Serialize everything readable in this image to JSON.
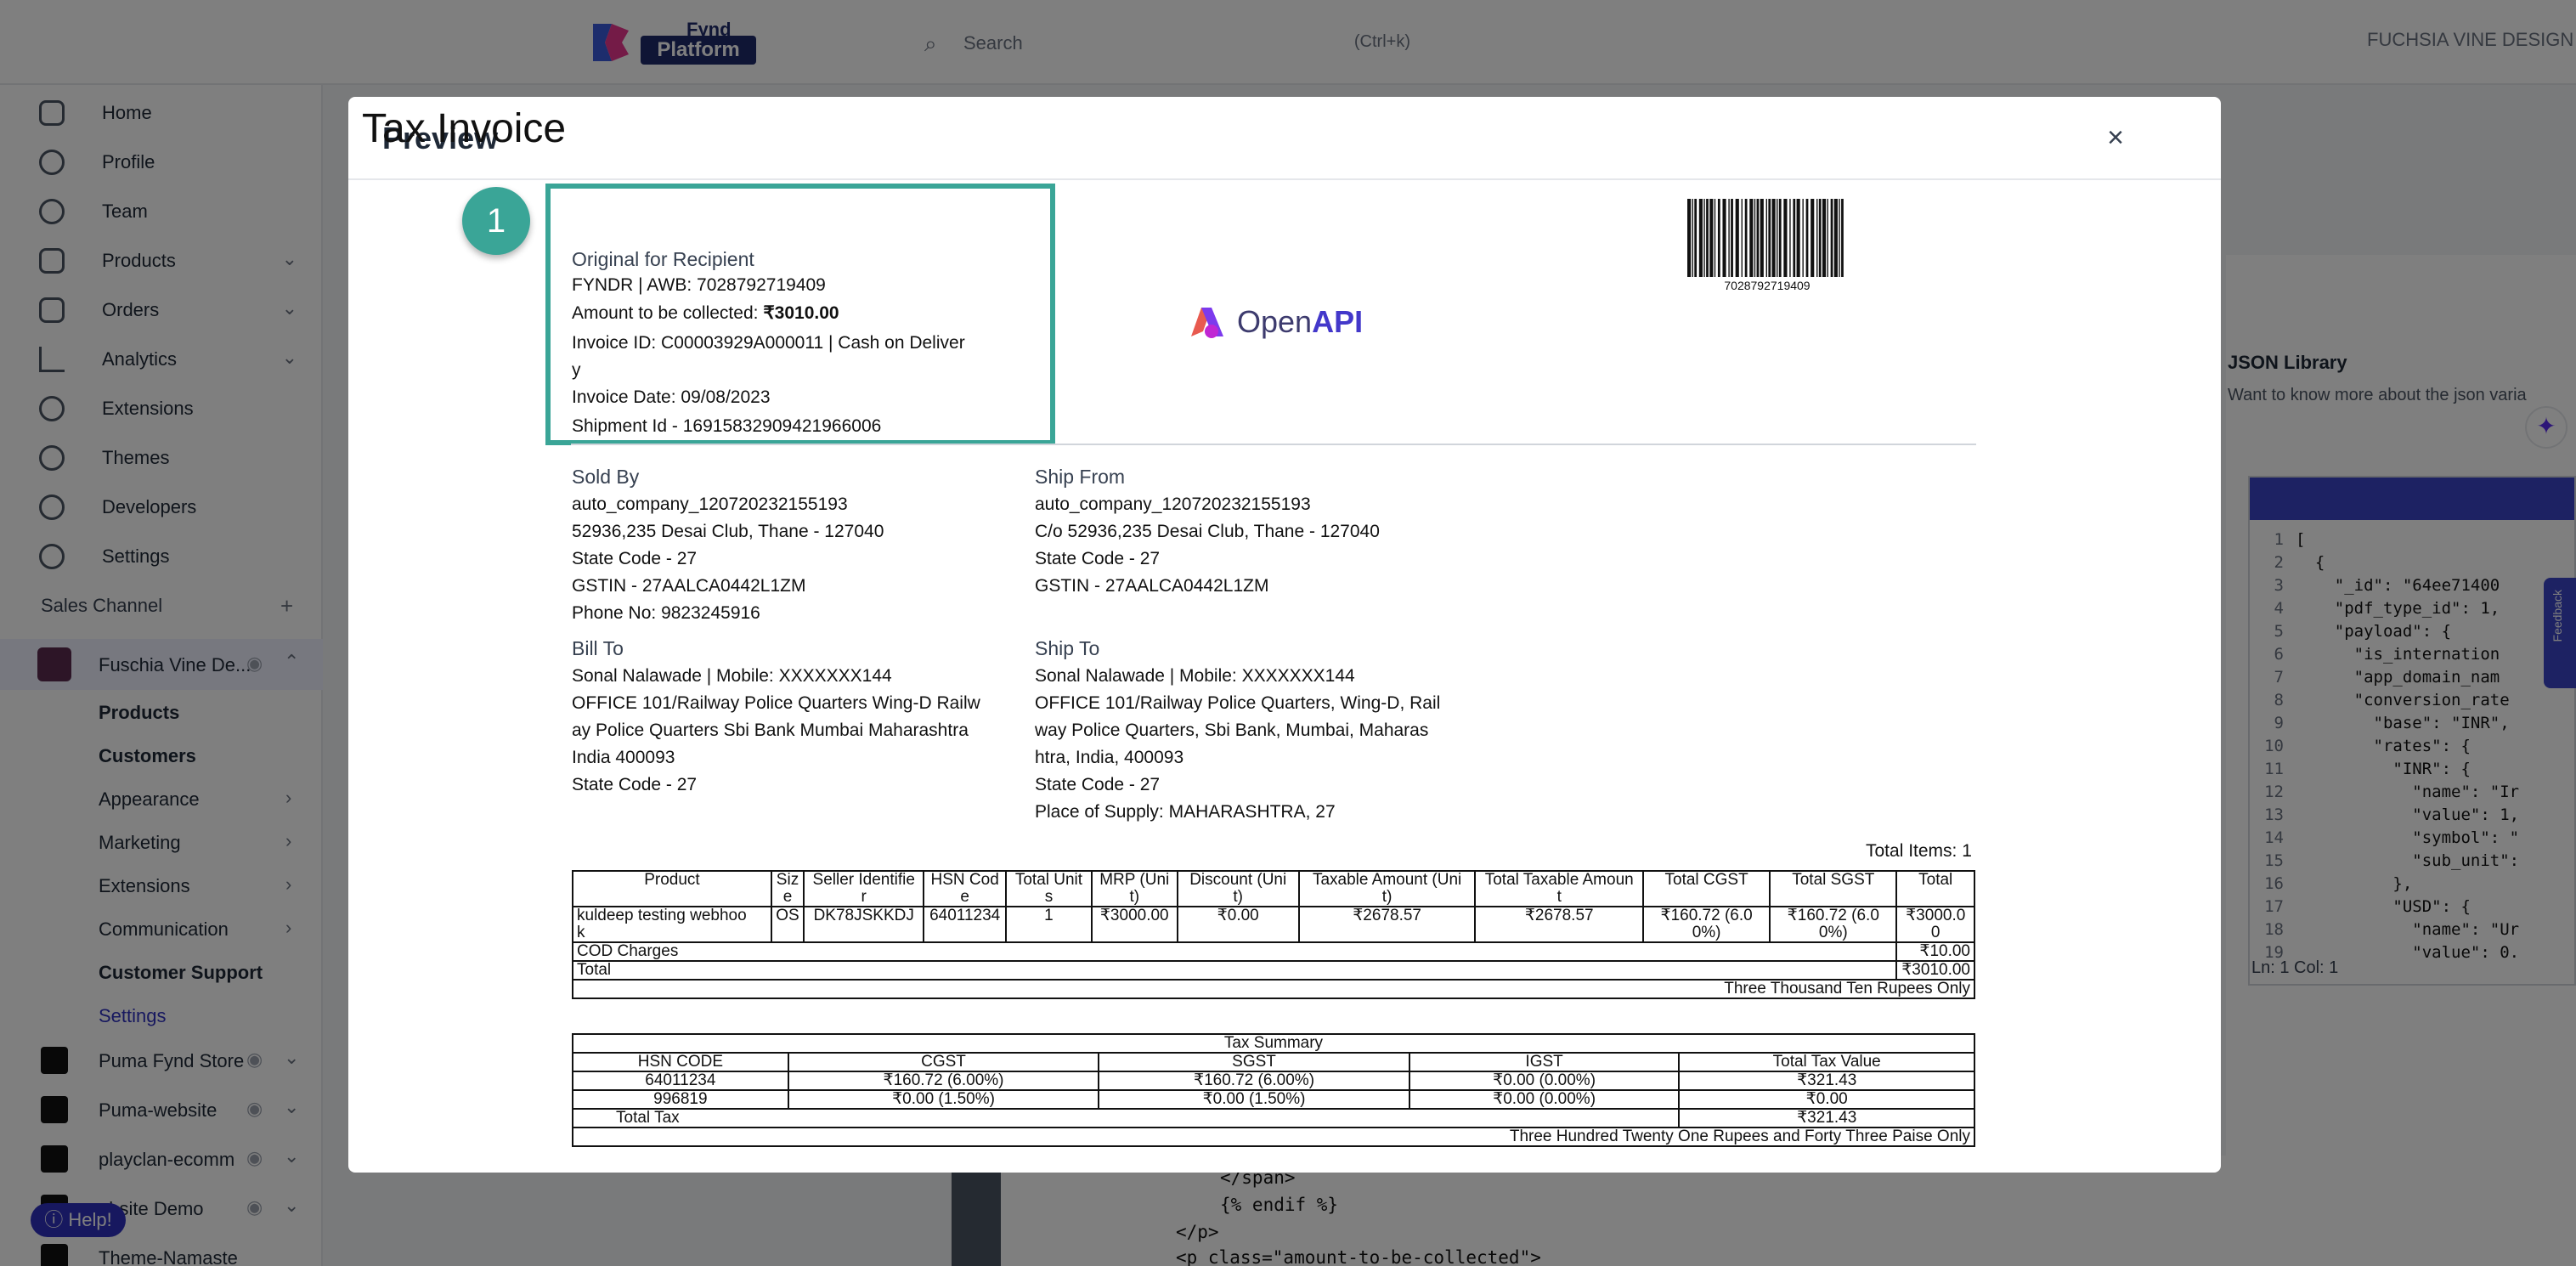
{
  "app": {
    "logo_small": "Fynd",
    "logo_big": "Platform",
    "search_placeholder": "Search",
    "search_shortcut": "(Ctrl+k)",
    "company": "FUCHSIA VINE DESIGN"
  },
  "sidebar": {
    "items": [
      {
        "label": "Home",
        "icon": "home-icon"
      },
      {
        "label": "Profile",
        "icon": "profile-icon"
      },
      {
        "label": "Team",
        "icon": "team-icon"
      },
      {
        "label": "Products",
        "icon": "products-icon"
      },
      {
        "label": "Orders",
        "icon": "orders-icon"
      },
      {
        "label": "Analytics",
        "icon": "analytics-icon"
      },
      {
        "label": "Extensions",
        "icon": "extensions-icon"
      },
      {
        "label": "Themes",
        "icon": "themes-icon"
      },
      {
        "label": "Developers",
        "icon": "developers-icon"
      },
      {
        "label": "Settings",
        "icon": "settings-icon"
      }
    ],
    "sales_channel_label": "Sales Channel",
    "active_channel": "Fuschia Vine De...",
    "sub_items": [
      "Products",
      "Customers",
      "Appearance",
      "Marketing",
      "Extensions",
      "Communication",
      "Customer Support",
      "Settings"
    ],
    "channels": [
      "Puma Fynd Store",
      "Puma-website",
      "playclan-ecomm",
      "ebsite Demo",
      "Theme-Namaste"
    ],
    "help_label": "Help!"
  },
  "right_panel": {
    "json_title": "JSON Library",
    "json_subtitle": "Want to know more about the json varia",
    "editor_lines": [
      "[",
      "  {",
      "    \"_id\": \"64ee71400",
      "    \"pdf_type_id\": 1,",
      "    \"payload\": {",
      "      \"is_internation",
      "      \"app_domain_nam",
      "      \"conversion_rate",
      "        \"base\": \"INR\",",
      "        \"rates\": {",
      "          \"INR\": {",
      "            \"name\": \"Ir",
      "            \"value\": 1,",
      "            \"symbol\": \"",
      "            \"sub_unit\":",
      "          },",
      "          \"USD\": {",
      "            \"name\": \"Ur",
      "            \"value\": 0."
    ],
    "status": "Ln: 1    Col: 1",
    "feedback_label": "Feedback"
  },
  "bottom_code": [
    "</span>",
    "{% endif %}",
    "</p>",
    "<p class=\"amount-to-be-collected\">"
  ],
  "modal": {
    "title": "Preview",
    "close_label": "×",
    "step_number": "1"
  },
  "invoice": {
    "title": "Tax Invoice",
    "subtitle": "Original for Recipient",
    "awb_line": "FYNDR | AWB: 7028792719409",
    "amount_label": "Amount to be collected: ",
    "amount_value": "₹3010.00",
    "invoice_id_line1": "Invoice ID: C00003929A000011 | Cash on Deliver",
    "invoice_id_line2": "y",
    "invoice_date": "Invoice Date: 09/08/2023",
    "shipment_id": "Shipment Id - 16915832909421966006",
    "barcode_number": "7028792719409",
    "logo_text_a": "Open",
    "logo_text_b": "API",
    "sold_by": {
      "heading": "Sold By",
      "lines": [
        "auto_company_120720232155193",
        "52936,235 Desai Club, Thane - 127040",
        "State Code - 27",
        "GSTIN - 27AALCA0442L1ZM",
        "Phone No: 9823245916"
      ]
    },
    "ship_from": {
      "heading": "Ship From",
      "lines": [
        "auto_company_120720232155193",
        "C/o 52936,235 Desai Club, Thane - 127040",
        "State Code - 27",
        "GSTIN - 27AALCA0442L1ZM"
      ]
    },
    "bill_to": {
      "heading": "Bill To",
      "lines": [
        "Sonal Nalawade | Mobile: XXXXXXX144",
        "OFFICE 101/Railway Police Quarters Wing-D Railw",
        "ay Police Quarters Sbi Bank Mumbai Maharashtra",
        "India 400093",
        "State Code - 27"
      ]
    },
    "ship_to": {
      "heading": "Ship To",
      "lines": [
        "Sonal Nalawade | Mobile: XXXXXXX144",
        "OFFICE 101/Railway Police Quarters, Wing-D, Rail",
        "way Police Quarters, Sbi Bank, Mumbai, Maharas",
        "htra, India, 400093",
        "State Code - 27",
        "Place of Supply: MAHARASHTRA, 27"
      ]
    },
    "total_items": "Total Items: 1",
    "items_table": {
      "headers": [
        "Product",
        "Siz\ne",
        "Seller Identifie\nr",
        "HSN Cod\ne",
        "Total Unit\ns",
        "MRP (Uni\nt)",
        "Discount (Uni\nt)",
        "Taxable Amount (Uni\nt)",
        "Total Taxable Amoun\nt",
        "Total CGST",
        "Total SGST",
        "Total"
      ],
      "row": [
        "kuldeep testing webhoo\nk",
        "OS",
        "DK78JSKKDJ",
        "64011234",
        "1",
        "₹3000.00",
        "₹0.00",
        "₹2678.57",
        "₹2678.57",
        "₹160.72 (6.0\n0%)",
        "₹160.72 (6.0\n0%)",
        "₹3000.0\n0"
      ],
      "cod_label": "COD Charges",
      "cod_value": "₹10.00",
      "total_label": "Total",
      "total_value": "₹3010.00",
      "in_words": "Three Thousand Ten Rupees Only"
    },
    "tax_table": {
      "title": "Tax Summary",
      "headers": [
        "HSN CODE",
        "CGST",
        "SGST",
        "IGST",
        "Total Tax Value"
      ],
      "rows": [
        [
          "64011234",
          "₹160.72 (6.00%)",
          "₹160.72 (6.00%)",
          "₹0.00 (0.00%)",
          "₹321.43"
        ],
        [
          "996819",
          "₹0.00 (1.50%)",
          "₹0.00 (1.50%)",
          "₹0.00 (0.00%)",
          "₹0.00"
        ]
      ],
      "total_label": "Total Tax",
      "total_value": "₹321.43",
      "in_words": "Three Hundred Twenty One Rupees and Forty Three Paise Only"
    }
  }
}
